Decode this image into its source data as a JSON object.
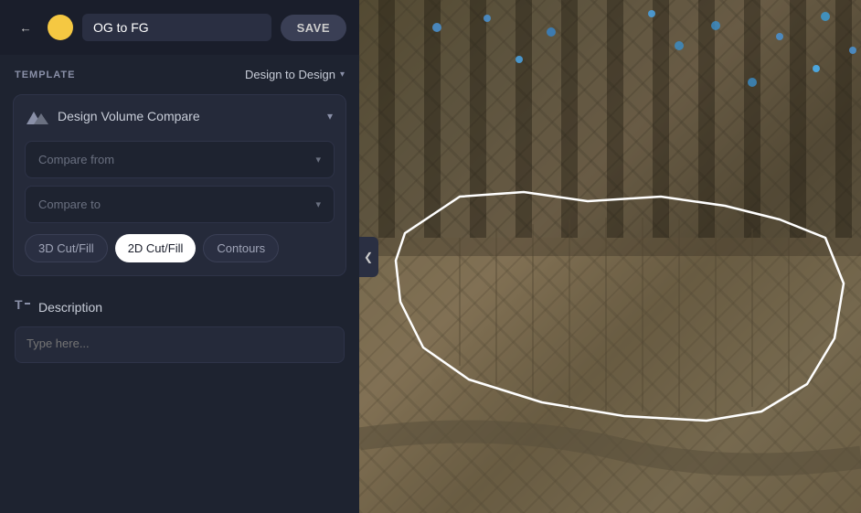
{
  "header": {
    "report_name": "OG to FG",
    "save_label": "SAVE"
  },
  "template": {
    "label": "TEMPLATE",
    "selected": "Design to Design"
  },
  "card": {
    "icon": "▲▲",
    "title": "Design Volume Compare",
    "compare_from_placeholder": "Compare from",
    "compare_to_placeholder": "Compare to"
  },
  "view_buttons": [
    {
      "label": "3D Cut/Fill",
      "active": false
    },
    {
      "label": "2D Cut/Fill",
      "active": true
    },
    {
      "label": "Contours",
      "active": false
    }
  ],
  "description": {
    "label": "Description",
    "placeholder": "Type here..."
  },
  "icons": {
    "back": "←",
    "chevron_down": "▾",
    "chevron_right": "❯"
  }
}
